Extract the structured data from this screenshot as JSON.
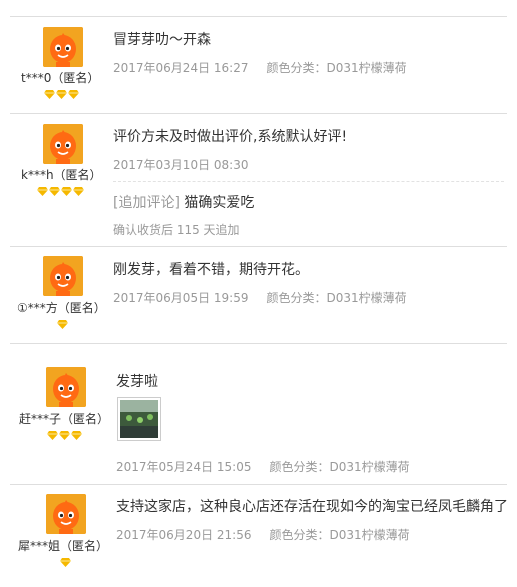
{
  "reviews": [
    {
      "user": "t***0（匿名）",
      "content": "冒芽芽叻～开森",
      "date": "2017年06月24日 16:27",
      "sku": "颜色分类：D031柠檬薄荷",
      "diamonds": 3
    },
    {
      "user": "k***h（匿名）",
      "content": "评价方未及时做出评价,系统默认好评!",
      "date": "2017年03月10日 08:30",
      "sku": "",
      "diamonds": 4,
      "append": {
        "tag": "[追加评论]",
        "text": "猫确实爱吃",
        "note": "确认收货后 115 天追加"
      }
    },
    {
      "user": "①***方（匿名）",
      "content": "刚发芽，看着不错，期待开花。",
      "date": "2017年06月05日 19:59",
      "sku": "颜色分类：D031柠檬薄荷",
      "diamonds": 1
    },
    {
      "user": "赶***子（匿名）",
      "content": "发芽啦",
      "date": "2017年05月24日 15:05",
      "sku": "颜色分类：D031柠檬薄荷",
      "diamonds": 3,
      "has_photo": true
    },
    {
      "user": "犀***姐（匿名）",
      "content": "支持这家店，这种良心店还存活在现如今的淘宝已经凤毛麟角了",
      "date": "2017年06月20日 21:56",
      "sku": "颜色分类：D031柠檬薄荷",
      "diamonds": 1
    }
  ],
  "colors": {
    "avatar_bg": "#f2a420",
    "diamond": "#f5b800",
    "meta": "#999999",
    "separator": "#dedede"
  }
}
